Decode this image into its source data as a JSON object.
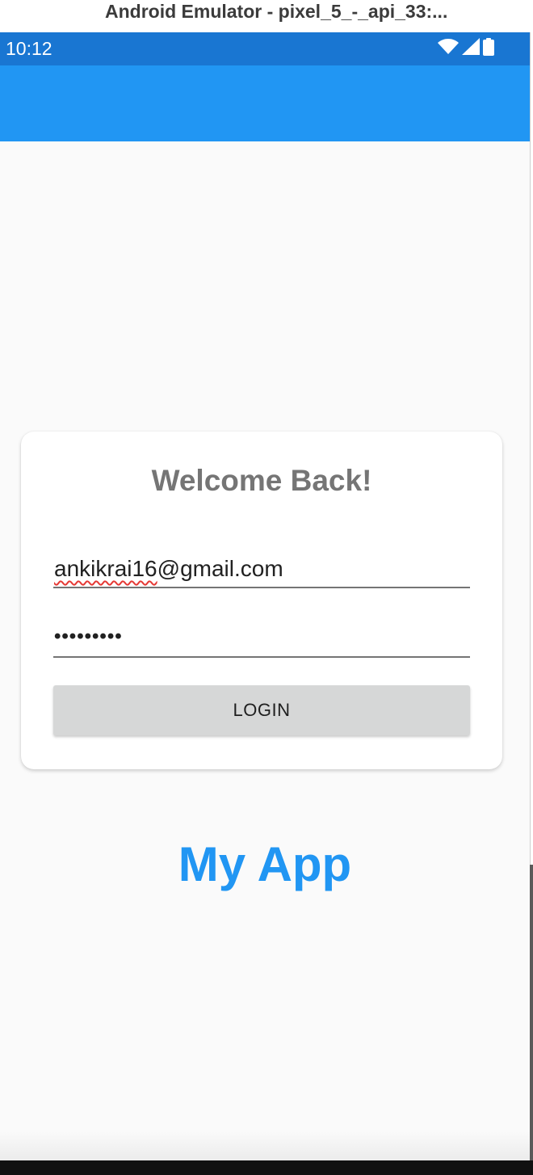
{
  "window": {
    "title": "Android Emulator - pixel_5_-_api_33:..."
  },
  "status_bar": {
    "time": "10:12",
    "icons": [
      "wifi-icon",
      "cell-signal-icon",
      "battery-icon"
    ],
    "background_color": "#1976d2"
  },
  "app_bar": {
    "background_color": "#2196f3"
  },
  "login_card": {
    "title": "Welcome Back!",
    "email": {
      "value_misspelled": "ankikrai16",
      "value_rest": "@gmail.com"
    },
    "password": {
      "value_masked": "•••••••••"
    },
    "login_button_label": "LOGIN"
  },
  "footer": {
    "app_name": "My App",
    "app_name_color": "#2196f3"
  }
}
